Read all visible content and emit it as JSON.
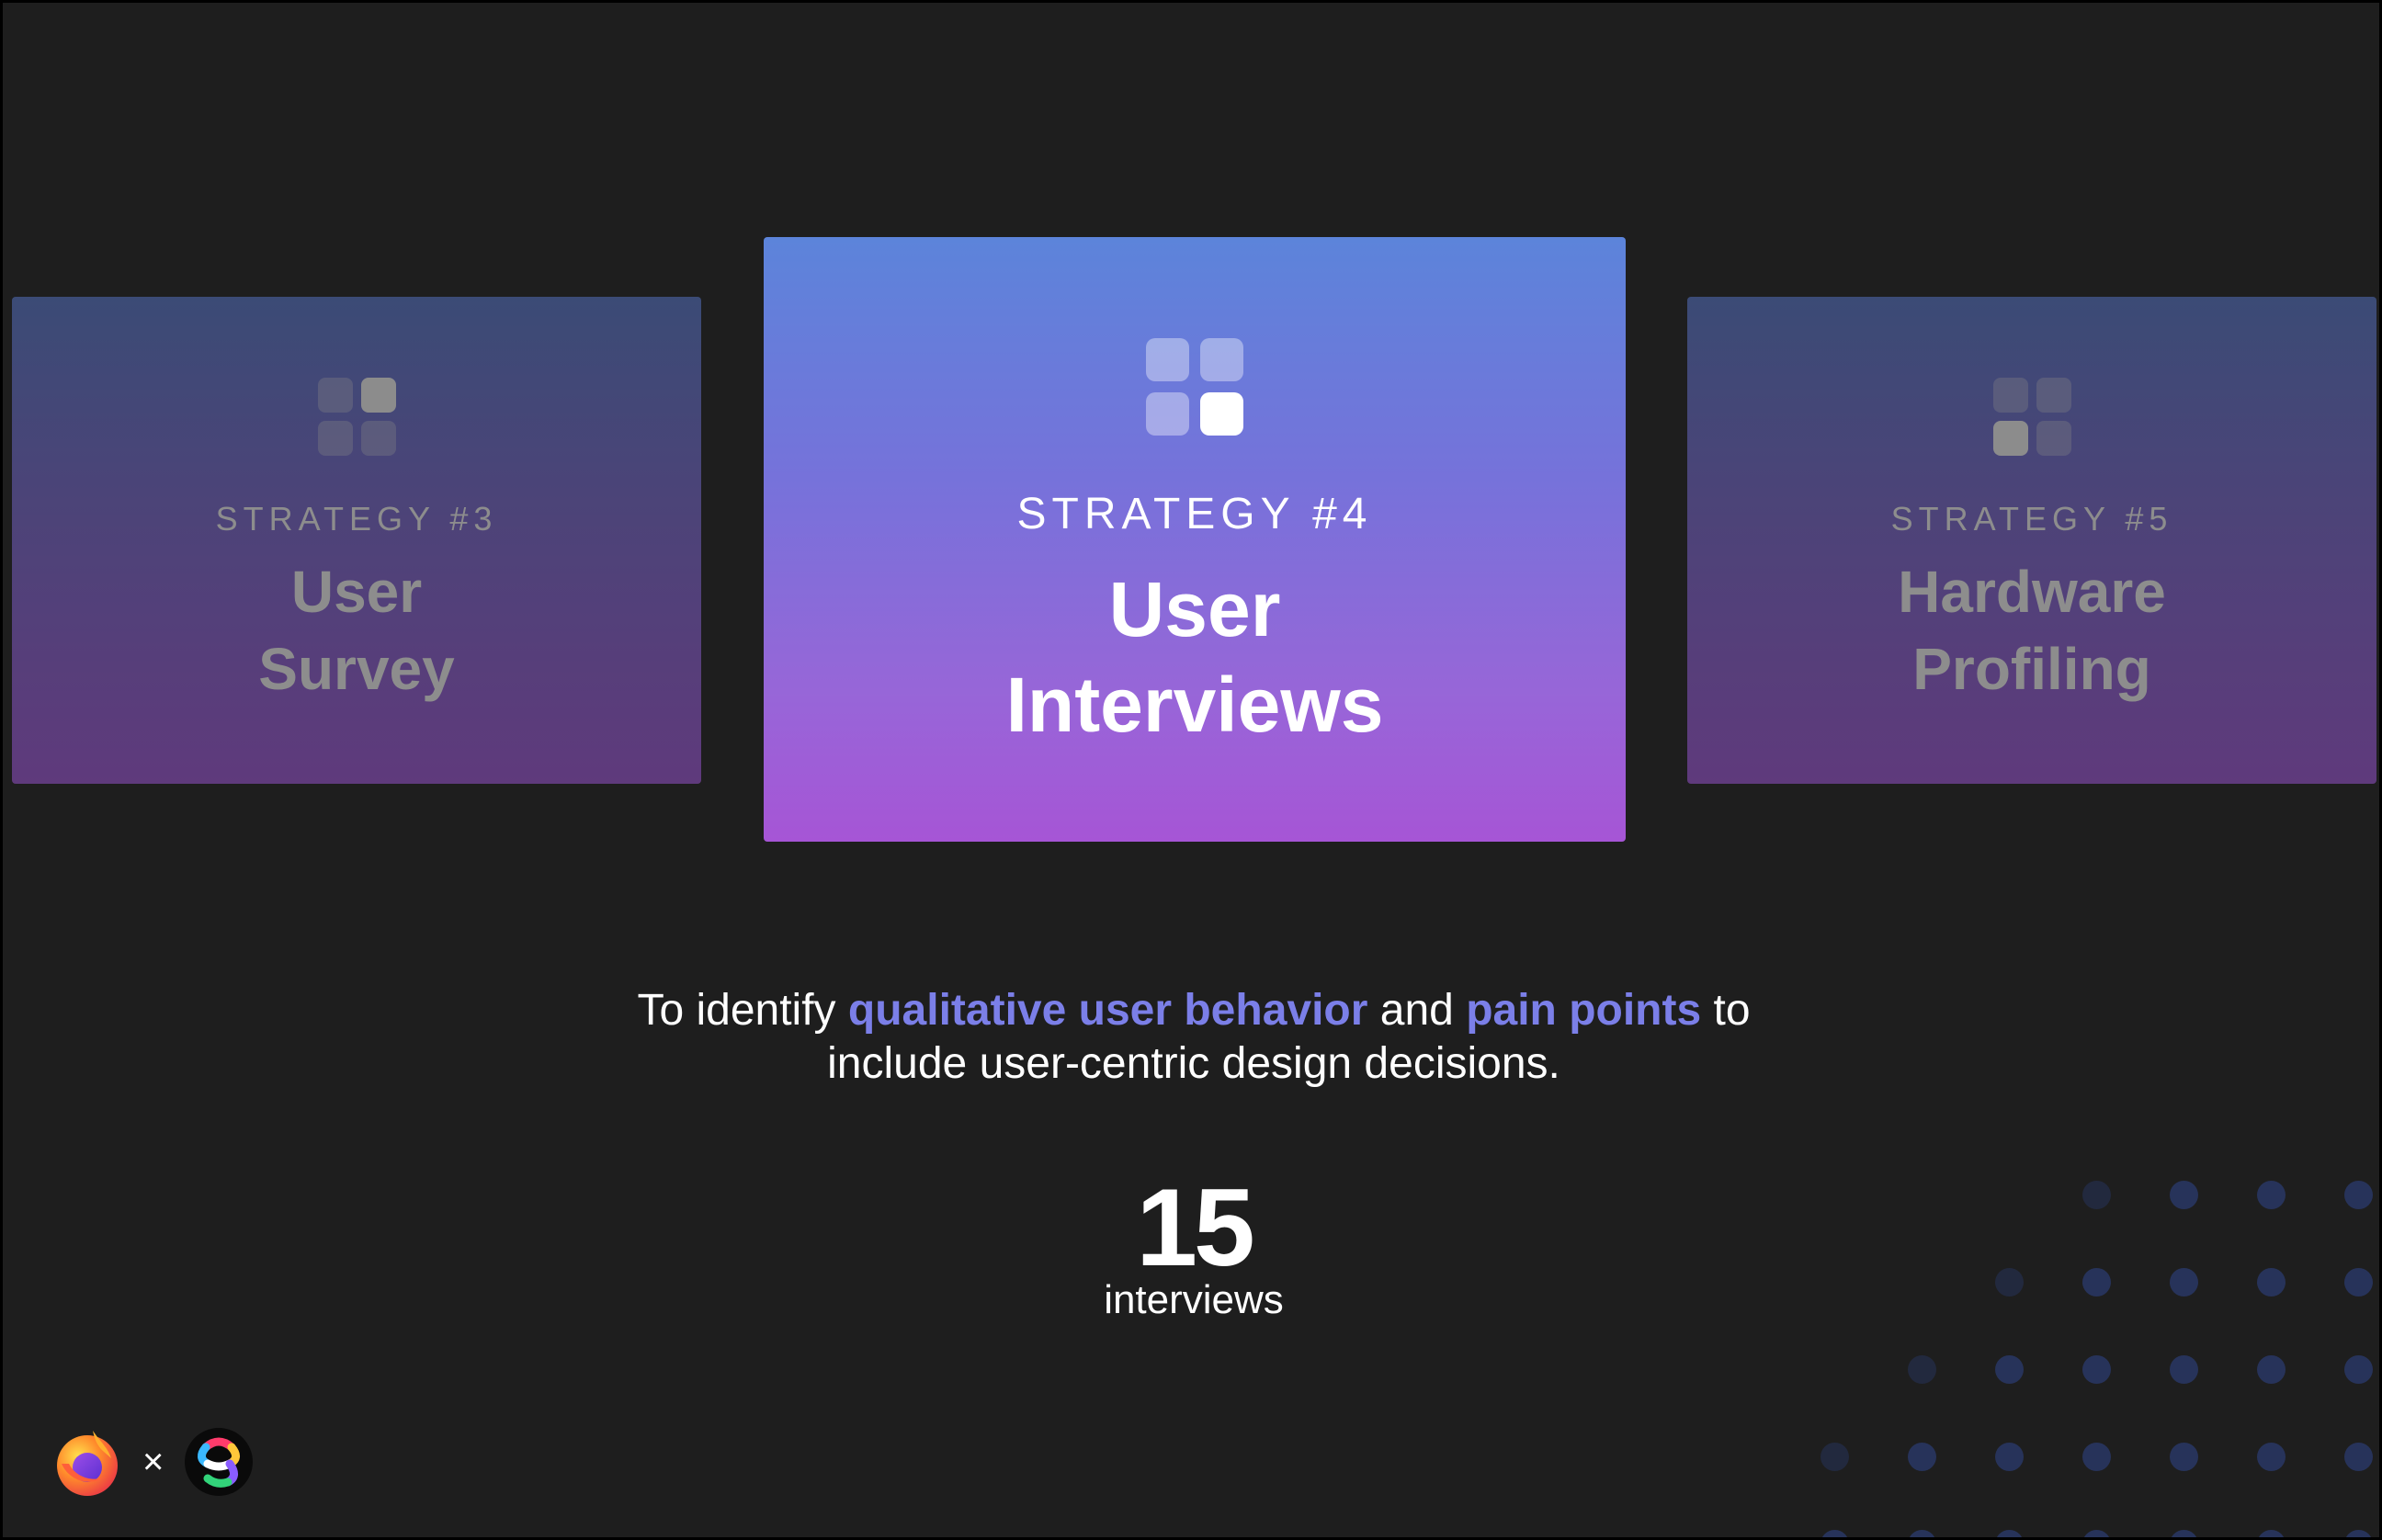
{
  "cards": {
    "left": {
      "strategy": "STRATEGY #3",
      "title_line1": "User",
      "title_line2": "Survey",
      "icon": "grid-four-squares-icon"
    },
    "center": {
      "strategy": "STRATEGY #4",
      "title_line1": "User",
      "title_line2": "Interviews",
      "icon": "grid-four-squares-icon"
    },
    "right": {
      "strategy": "STRATEGY #5",
      "title_line1": "Hardware",
      "title_line2": "Profiling",
      "icon": "grid-four-squares-icon"
    }
  },
  "description": {
    "part1": "To identify ",
    "highlight1": "qualitative user behavior",
    "part2": " and ",
    "highlight2": "pain points",
    "part3": " to",
    "line2": "include user-centric design decisions."
  },
  "stat": {
    "value": "15",
    "label": "interviews"
  },
  "logos": {
    "left": "firefox-logo-icon",
    "separator": "×",
    "right": "partner-logo-icon"
  },
  "colors": {
    "background": "#1e1e1e",
    "highlight": "#7b7fe8",
    "center_card_top": "#5c84da",
    "center_card_bottom": "#a655d6",
    "dot": "#27335a"
  }
}
